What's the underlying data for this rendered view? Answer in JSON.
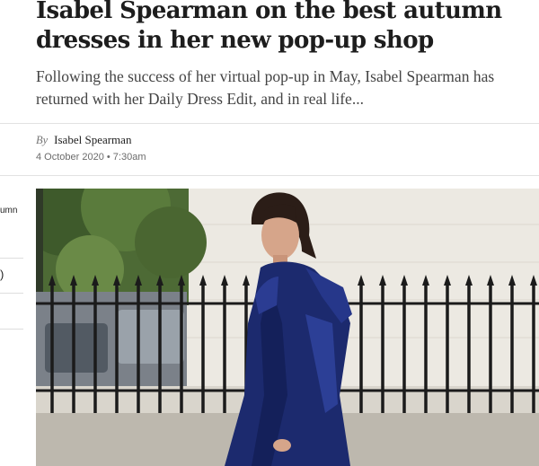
{
  "article": {
    "headline": "Isabel Spearman on the best autumn dresses in her new pop-up shop",
    "standfirst": "Following the success of her virtual pop-up in May, Isabel Spearman has returned with her Daily Dress Edit, and in real life...",
    "byline_prefix": "By",
    "author": "Isabel Spearman",
    "date": "4 October 2020 • 7:30am"
  },
  "sidebar_fragments": {
    "line_1": "umn",
    "line_2": ")"
  },
  "icons": [
    "photo"
  ],
  "colors": {
    "headline": "#1d1d1d",
    "standfirst": "#444444",
    "meta": "#6b6b6b",
    "divider": "#e2e2e2",
    "dress": "#1c2a6e"
  }
}
